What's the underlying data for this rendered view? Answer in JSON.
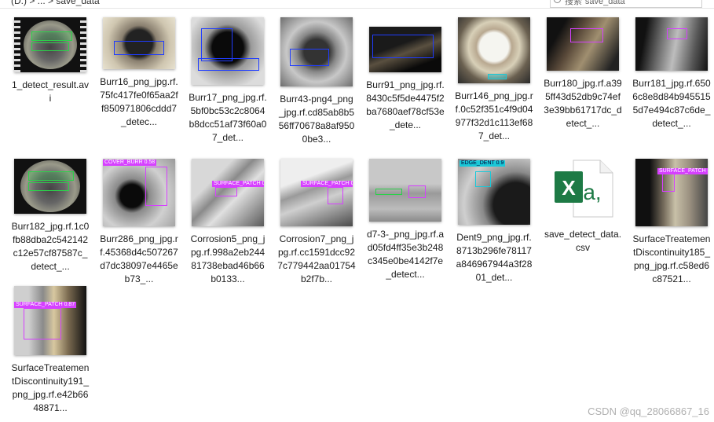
{
  "breadcrumb": "(D:) > ... > save_data",
  "search_placeholder": "搜索\"save_data\"",
  "files": [
    {
      "name": "1_detect_result.avi",
      "kind": "video"
    },
    {
      "name": "Burr16_png_jpg.rf.75fc417fe0f65aa2ff850971806cddd7_detec...",
      "kind": "image"
    },
    {
      "name": "Burr17_png_jpg.rf.5bf0bc53c2c8064b8dcc51af73f60a07_det...",
      "kind": "image"
    },
    {
      "name": "Burr43-png4_png_jpg.rf.cd85ab8b556ff70678a8af9500be3...",
      "kind": "image"
    },
    {
      "name": "Burr91_png_jpg.rf.8430c5f5de4475f2ba7680aef78cf53e_dete...",
      "kind": "image"
    },
    {
      "name": "Burr146_png_jpg.rf.0c52f351c4f9d04977f32d1c113ef687_det...",
      "kind": "image"
    },
    {
      "name": "Burr180_jpg.rf.a395ff43d52db9c74ef3e39bb61717dc_detect_...",
      "kind": "image"
    },
    {
      "name": "Burr181_jpg.rf.6506c8e8d84b9455155d7e494c87c6de_detect_...",
      "kind": "image"
    },
    {
      "name": "Burr182_jpg.rf.1c0fb88dba2c542142c12e57cf87587c_detect_...",
      "kind": "image"
    },
    {
      "name": "Burr286_png_jpg.rf.45368d4c507267d7dc38097e4465eb73_...",
      "kind": "image"
    },
    {
      "name": "Corrosion5_png_jpg.rf.998a2eb24481738ebad46b66b0133...",
      "kind": "image"
    },
    {
      "name": "Corrosion7_png_jpg.rf.cc1591dcc927c779442aa01754b2f7b...",
      "kind": "image"
    },
    {
      "name": "d7-3-_png_jpg.rf.ad05fd4ff35e3b248c345e0be4142f7e_detect...",
      "kind": "image"
    },
    {
      "name": "Dent9_png_jpg.rf.8713b296fe78117a846967944a3f2801_det...",
      "kind": "image"
    },
    {
      "name": "save_detect_data.csv",
      "kind": "csv"
    },
    {
      "name": "SurfaceTreatementDiscontinuity185_png_jpg.rf.c58ed6c87521...",
      "kind": "image"
    },
    {
      "name": "SurfaceTreatementDiscontinuity191_png_jpg.rf.e42b6648871...",
      "kind": "image"
    }
  ],
  "detections": {
    "burr286": "COVER_BURR  0.58",
    "corrosion5": "SURFACE_PATCH  0.76",
    "corrosion7": "SURFACE_PATCH  0.8",
    "dent9": "EDGE_DENT  0.9",
    "std185": "SURFACE_PATCH  0.8",
    "std191": "SURFACE_PATCH  0.87"
  },
  "watermark": "CSDN @qq_28066867_16",
  "colors": {
    "blue_box": "#1f3cff",
    "magenta_box": "#d640ff",
    "cyan_box": "#1ac8d8",
    "green_box": "#2bd14a",
    "excel_green": "#1d7a45"
  }
}
